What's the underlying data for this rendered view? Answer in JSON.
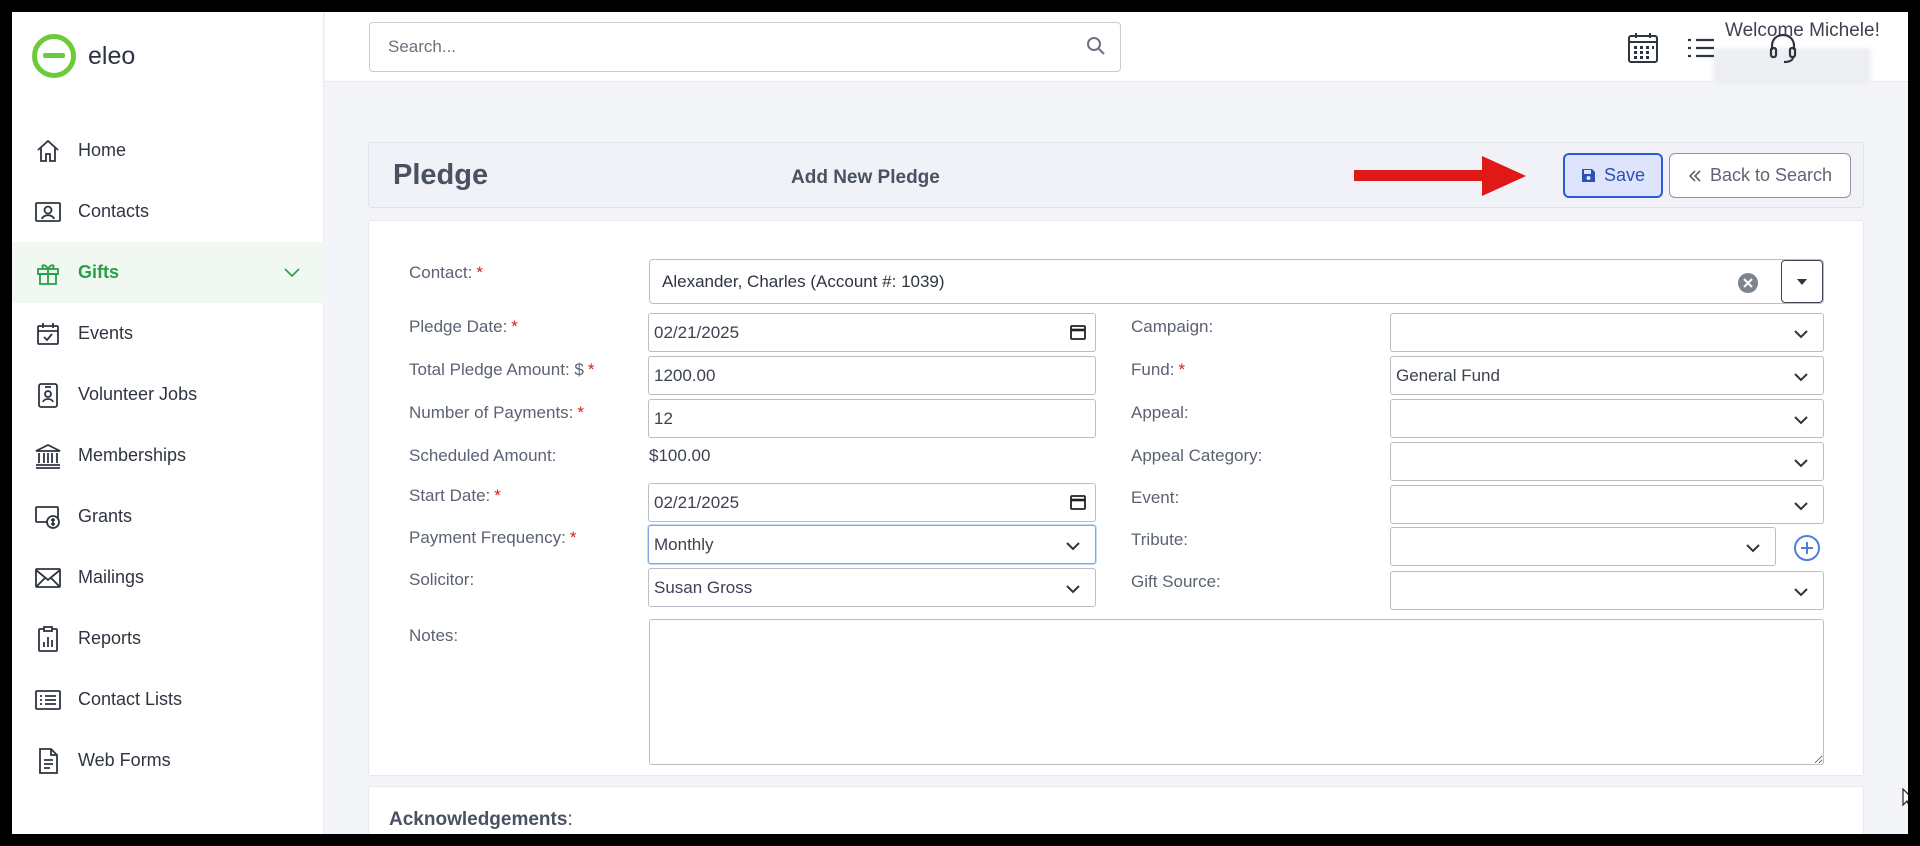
{
  "app": {
    "logo_text": "eleo",
    "brand_color": "#6ccb38",
    "accent_color": "#27a048"
  },
  "sidebar": {
    "items": [
      {
        "label": "Home",
        "icon": "home-icon",
        "active": false
      },
      {
        "label": "Contacts",
        "icon": "contact-card-icon",
        "active": false
      },
      {
        "label": "Gifts",
        "icon": "gift-icon",
        "active": true,
        "expandable": true
      },
      {
        "label": "Events",
        "icon": "calendar-check-icon",
        "active": false
      },
      {
        "label": "Volunteer Jobs",
        "icon": "badge-icon",
        "active": false
      },
      {
        "label": "Memberships",
        "icon": "institution-icon",
        "active": false
      },
      {
        "label": "Grants",
        "icon": "money-icon",
        "active": false
      },
      {
        "label": "Mailings",
        "icon": "envelope-icon",
        "active": false
      },
      {
        "label": "Reports",
        "icon": "report-icon",
        "active": false
      },
      {
        "label": "Contact Lists",
        "icon": "list-icon",
        "active": false
      },
      {
        "label": "Web Forms",
        "icon": "document-icon",
        "active": false
      }
    ]
  },
  "topbar": {
    "search_placeholder": "Search...",
    "welcome": "Welcome Michele!",
    "icons": [
      "calendar-grid-icon",
      "list-icon",
      "headset-icon",
      "avatar"
    ]
  },
  "page": {
    "title": "Pledge",
    "subtitle": "Add New Pledge",
    "save_label": "Save",
    "back_label": "Back to Search"
  },
  "form": {
    "contact": {
      "label": "Contact:",
      "value": "Alexander, Charles (Account #: 1039)"
    },
    "pledge_date": {
      "label": "Pledge Date:",
      "value": "02/21/2025"
    },
    "total_amount": {
      "label": "Total Pledge Amount: $",
      "value": "1200.00"
    },
    "num_payments": {
      "label": "Number of Payments:",
      "value": "12"
    },
    "scheduled_amount": {
      "label": "Scheduled Amount:",
      "value": "$100.00"
    },
    "start_date": {
      "label": "Start Date:",
      "value": "02/21/2025"
    },
    "payment_frequency": {
      "label": "Payment Frequency:",
      "value": "Monthly"
    },
    "solicitor": {
      "label": "Solicitor:",
      "value": "Susan Gross"
    },
    "notes": {
      "label": "Notes:",
      "value": ""
    },
    "campaign": {
      "label": "Campaign:",
      "value": ""
    },
    "fund": {
      "label": "Fund:",
      "value": "General Fund"
    },
    "appeal": {
      "label": "Appeal:",
      "value": ""
    },
    "appeal_category": {
      "label": "Appeal Category:",
      "value": ""
    },
    "event": {
      "label": "Event:",
      "value": ""
    },
    "tribute": {
      "label": "Tribute:",
      "value": ""
    },
    "gift_source": {
      "label": "Gift Source:",
      "value": ""
    },
    "required_mark": "*"
  },
  "acknowledgements": {
    "title": "Acknowledgements",
    "suffix": ":"
  }
}
